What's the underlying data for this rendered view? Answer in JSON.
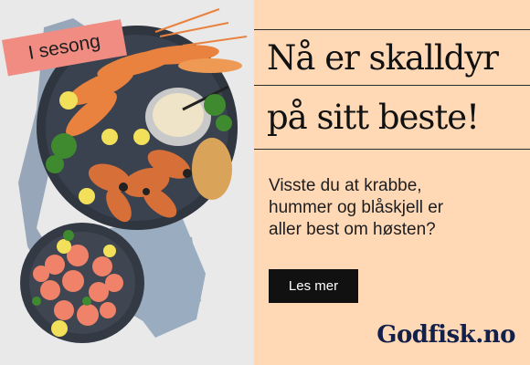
{
  "ad": {
    "badge": "I sesong",
    "headline": [
      "Nå er skalldyr",
      "på sitt beste!"
    ],
    "body_lines": [
      "Visste du at krabbe,",
      "hummer og blåskjell er",
      "aller best om høsten?"
    ],
    "cta_label": "Les mer",
    "brand": "Godfisk.no"
  },
  "colors": {
    "panel_background": "#ffd9b6",
    "badge_background": "#f08c82",
    "cta_background": "#111111",
    "brand_color": "#13204a"
  }
}
